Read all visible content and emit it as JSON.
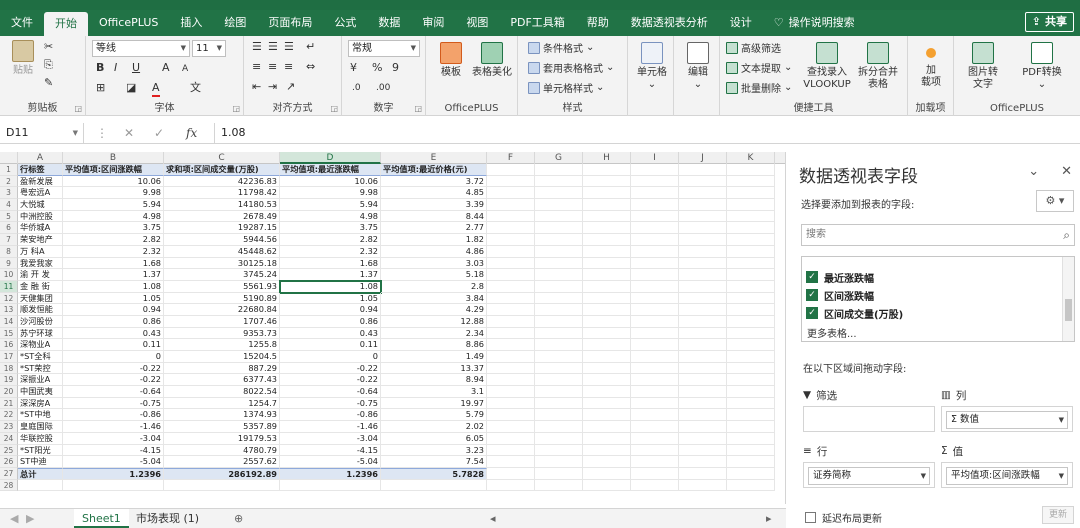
{
  "ribbon_tabs": [
    "文件",
    "开始",
    "OfficePLUS",
    "插入",
    "绘图",
    "页面布局",
    "公式",
    "数据",
    "审阅",
    "视图",
    "PDF工具箱",
    "帮助",
    "数据透视表分析",
    "设计"
  ],
  "active_tab": "开始",
  "search_label": "操作说明搜索",
  "share_label": "共享",
  "clipboard": {
    "paste": "贴贴",
    "group": "剪贴板"
  },
  "font": {
    "name": "等线",
    "size": "11",
    "group": "字体",
    "bold": "B",
    "italic": "I",
    "underline": "U",
    "grow": "A",
    "shrink": "A",
    "pinyin": "文",
    "fill": "A"
  },
  "alignment": {
    "group": "对齐方式"
  },
  "number": {
    "format": "常规",
    "group": "数字",
    "percent": "%",
    "comma": "9"
  },
  "officeplus": {
    "template": "模板",
    "beautify": "表格美化",
    "group": "OfficePLUS"
  },
  "styles": {
    "conditional": "条件格式",
    "table": "套用表格格式",
    "cell": "单元格样式",
    "group": "样式"
  },
  "cells": {
    "label": "单元格"
  },
  "editing": {
    "label": "编辑"
  },
  "tools": {
    "advanced_filter": "高级筛选",
    "text_extract": "文本提取",
    "batch_delete": "批量删除",
    "vlookup": "查找录入",
    "vlookup2": "VLOOKUP",
    "split": "拆分合并",
    "split2": "表格",
    "group": "便捷工具"
  },
  "addins": {
    "label": "加",
    "label2": "载项",
    "group": "加载项"
  },
  "officeplus2": {
    "img2text": "图片转",
    "img2text2": "文字",
    "pdf": "PDF转换",
    "group": "OfficePLUS"
  },
  "formula_bar": {
    "cell": "D11",
    "fx": "fx",
    "value": "1.08"
  },
  "columns": [
    "A",
    "B",
    "C",
    "D",
    "E",
    "F",
    "G",
    "H",
    "I",
    "J",
    "K"
  ],
  "table": {
    "headers": [
      "行标签",
      "平均值项:区间涨跌幅",
      "求和项:区间成交量(万股)",
      "平均值项:最近涨跌幅",
      "平均值项:最近价格(元)"
    ],
    "rows": [
      [
        "盈新发展",
        "10.06",
        "42236.83",
        "10.06",
        "3.72"
      ],
      [
        "粤宏远A",
        "9.98",
        "11798.42",
        "9.98",
        "4.85"
      ],
      [
        "大悦城",
        "5.94",
        "14180.53",
        "5.94",
        "3.39"
      ],
      [
        "中洲控股",
        "4.98",
        "2678.49",
        "4.98",
        "8.44"
      ],
      [
        "华侨城A",
        "3.75",
        "19287.15",
        "3.75",
        "2.77"
      ],
      [
        "荣安地产",
        "2.82",
        "5944.56",
        "2.82",
        "1.82"
      ],
      [
        "万 科A",
        "2.32",
        "45448.62",
        "2.32",
        "4.86"
      ],
      [
        "我爱我家",
        "1.68",
        "30125.18",
        "1.68",
        "3.03"
      ],
      [
        "渝 开 发",
        "1.37",
        "3745.24",
        "1.37",
        "5.18"
      ],
      [
        "金 融 街",
        "1.08",
        "5561.93",
        "1.08",
        "2.8"
      ],
      [
        "天健集团",
        "1.05",
        "5190.89",
        "1.05",
        "3.84"
      ],
      [
        "顺发恒能",
        "0.94",
        "22680.84",
        "0.94",
        "4.29"
      ],
      [
        "沙河股份",
        "0.86",
        "1707.46",
        "0.86",
        "12.88"
      ],
      [
        "苏宁环球",
        "0.43",
        "9353.73",
        "0.43",
        "2.34"
      ],
      [
        "深物业A",
        "0.11",
        "1255.8",
        "0.11",
        "8.86"
      ],
      [
        "*ST全科",
        "0",
        "15204.5",
        "0",
        "1.49"
      ],
      [
        "*ST荣控",
        "-0.22",
        "887.29",
        "-0.22",
        "13.37"
      ],
      [
        "深振业A",
        "-0.22",
        "6377.43",
        "-0.22",
        "8.94"
      ],
      [
        "中国武夷",
        "-0.64",
        "8022.54",
        "-0.64",
        "3.1"
      ],
      [
        "深深房A",
        "-0.75",
        "1254.7",
        "-0.75",
        "19.97"
      ],
      [
        "*ST中地",
        "-0.86",
        "1374.93",
        "-0.86",
        "5.79"
      ],
      [
        "皇庭国际",
        "-1.46",
        "5357.89",
        "-1.46",
        "2.02"
      ],
      [
        "华联控股",
        "-3.04",
        "19179.53",
        "-3.04",
        "6.05"
      ],
      [
        "*ST阳光",
        "-4.15",
        "4780.79",
        "-4.15",
        "3.23"
      ],
      [
        "ST中迪",
        "-5.04",
        "2557.62",
        "-5.04",
        "7.54"
      ]
    ],
    "total": [
      "总计",
      "1.2396",
      "286192.89",
      "1.2396",
      "5.7828"
    ]
  },
  "sheet_tabs": [
    "Sheet1",
    "市场表现 (1)"
  ],
  "panel": {
    "title": "数据透视表字段",
    "choose": "选择要添加到报表的字段:",
    "search": "搜索",
    "fields": [
      "最近涨跌幅",
      "区间涨跌幅",
      "区间成交量(万股)"
    ],
    "more": "更多表格...",
    "drag": "在以下区域间拖动字段:",
    "filter": "筛选",
    "columns": "列",
    "column_value": "Σ 数值",
    "rows": "行",
    "values": "值",
    "row_field": "证券简称",
    "value_field": "平均值项:区间涨跌幅",
    "defer": "延迟布局更新",
    "update": "更新"
  },
  "colors": {
    "excel_green": "#217346",
    "header_fill": "#dde6f3"
  }
}
